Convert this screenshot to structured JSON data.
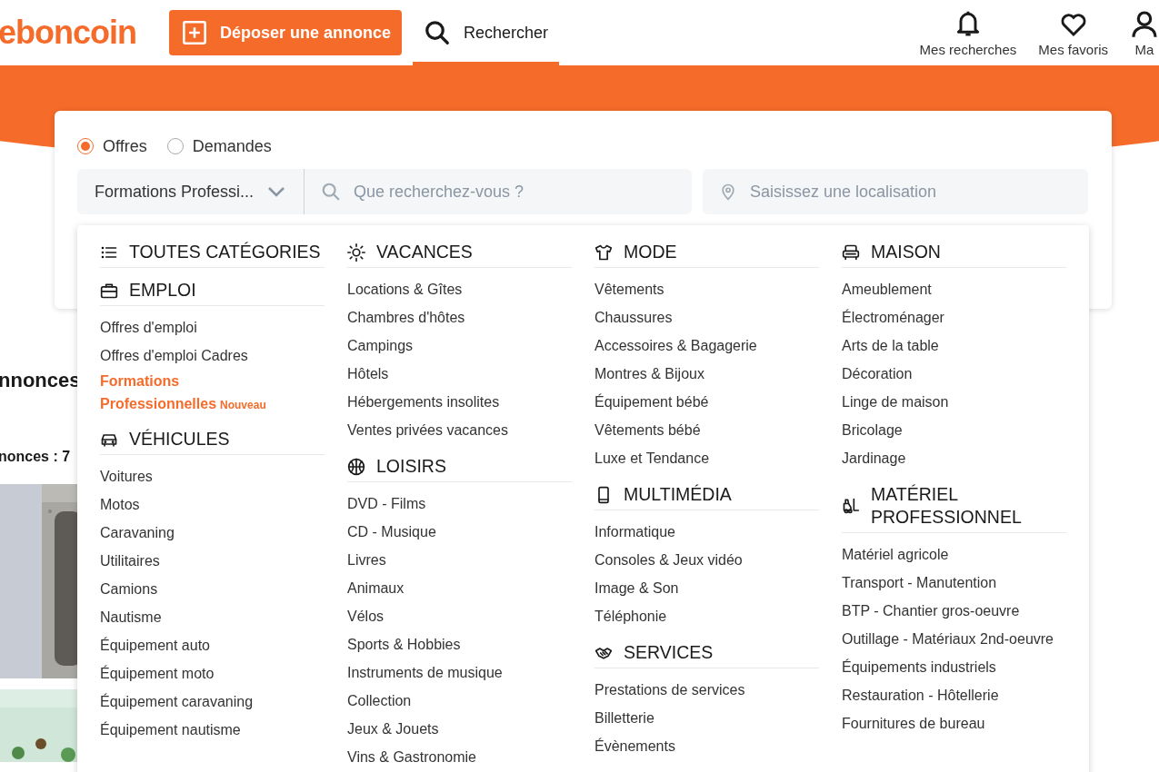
{
  "header": {
    "logo": "eboncoin",
    "post_button": "Déposer une annonce",
    "tabs": [
      {
        "label": "Rechercher",
        "selected": true
      }
    ],
    "nav": [
      "Mes recherches",
      "Mes favoris",
      "Ma"
    ]
  },
  "search": {
    "ad_types": [
      {
        "label": "Offres",
        "selected": true
      },
      {
        "label": "Demandes",
        "selected": false
      }
    ],
    "category": "Formations Professi...",
    "query_placeholder": "Que recherchez-vous ?",
    "location_placeholder": "Saisissez une localisation"
  },
  "background": {
    "heading": "nnonces",
    "count": "nonces : 7"
  },
  "category_menu": {
    "columns": [
      {
        "sections": [
          {
            "title": "TOUTES CATÉGORIES"
          },
          {
            "title": "EMPLOI",
            "items": [
              {
                "label": "Offres d'emploi",
                "selected": false
              },
              {
                "label": "Offres d'emploi Cadres",
                "selected": false
              },
              {
                "label": "Formations Professionnelles",
                "selected": true,
                "badge": "Nouveau"
              }
            ]
          },
          {
            "title": "VÉHICULES",
            "items": [
              {
                "label": "Voitures",
                "selected": false
              },
              {
                "label": "Motos",
                "selected": false
              },
              {
                "label": "Caravaning",
                "selected": false
              },
              {
                "label": "Utilitaires",
                "selected": false
              },
              {
                "label": "Camions",
                "selected": false
              },
              {
                "label": "Nautisme",
                "selected": false
              },
              {
                "label": "Équipement auto",
                "selected": false
              },
              {
                "label": "Équipement moto",
                "selected": false
              },
              {
                "label": "Équipement caravaning",
                "selected": false
              },
              {
                "label": "Équipement nautisme",
                "selected": false
              }
            ]
          }
        ]
      },
      {
        "sections": [
          {
            "title": "VACANCES",
            "items": [
              {
                "label": "Locations & Gîtes",
                "selected": false
              },
              {
                "label": "Chambres d'hôtes",
                "selected": false
              },
              {
                "label": "Campings",
                "selected": false
              },
              {
                "label": "Hôtels",
                "selected": false
              },
              {
                "label": "Hébergements insolites",
                "selected": false
              },
              {
                "label": "Ventes privées vacances",
                "selected": false
              }
            ]
          },
          {
            "title": "LOISIRS",
            "items": [
              {
                "label": "DVD - Films",
                "selected": false
              },
              {
                "label": "CD - Musique",
                "selected": false
              },
              {
                "label": "Livres",
                "selected": false
              },
              {
                "label": "Animaux",
                "selected": false
              },
              {
                "label": "Vélos",
                "selected": false
              },
              {
                "label": "Sports & Hobbies",
                "selected": false
              },
              {
                "label": "Instruments de musique",
                "selected": false
              },
              {
                "label": "Collection",
                "selected": false
              },
              {
                "label": "Jeux & Jouets",
                "selected": false
              },
              {
                "label": "Vins & Gastronomie",
                "selected": false
              }
            ]
          }
        ]
      },
      {
        "sections": [
          {
            "title": "MODE",
            "items": [
              {
                "label": "Vêtements",
                "selected": false
              },
              {
                "label": "Chaussures",
                "selected": false
              },
              {
                "label": "Accessoires & Bagagerie",
                "selected": false
              },
              {
                "label": "Montres & Bijoux",
                "selected": false
              },
              {
                "label": "Équipement bébé",
                "selected": false
              },
              {
                "label": "Vêtements bébé",
                "selected": false
              },
              {
                "label": "Luxe et Tendance",
                "selected": false
              }
            ]
          },
          {
            "title": "MULTIMÉDIA",
            "items": [
              {
                "label": "Informatique",
                "selected": false
              },
              {
                "label": "Consoles & Jeux vidéo",
                "selected": false
              },
              {
                "label": "Image & Son",
                "selected": false
              },
              {
                "label": "Téléphonie",
                "selected": false
              }
            ]
          },
          {
            "title": "SERVICES",
            "items": [
              {
                "label": "Prestations de services",
                "selected": false
              },
              {
                "label": "Billetterie",
                "selected": false
              },
              {
                "label": "Évènements",
                "selected": false
              }
            ]
          }
        ]
      },
      {
        "sections": [
          {
            "title": "MAISON",
            "items": [
              {
                "label": "Ameublement",
                "selected": false
              },
              {
                "label": "Électroménager",
                "selected": false
              },
              {
                "label": "Arts de la table",
                "selected": false
              },
              {
                "label": "Décoration",
                "selected": false
              },
              {
                "label": "Linge de maison",
                "selected": false
              },
              {
                "label": "Bricolage",
                "selected": false
              },
              {
                "label": "Jardinage",
                "selected": false
              }
            ]
          },
          {
            "title": "MATÉRIEL PROFESSIONNEL",
            "items": [
              {
                "label": "Matériel agricole",
                "selected": false
              },
              {
                "label": "Transport - Manutention",
                "selected": false
              },
              {
                "label": "BTP - Chantier gros-oeuvre",
                "selected": false
              },
              {
                "label": "Outillage - Matériaux 2nd-oeuvre",
                "selected": false
              },
              {
                "label": "Équipements industriels",
                "selected": false
              },
              {
                "label": "Restauration - Hôtellerie",
                "selected": false
              },
              {
                "label": "Fournitures de bureau",
                "selected": false
              }
            ]
          }
        ]
      }
    ]
  }
}
